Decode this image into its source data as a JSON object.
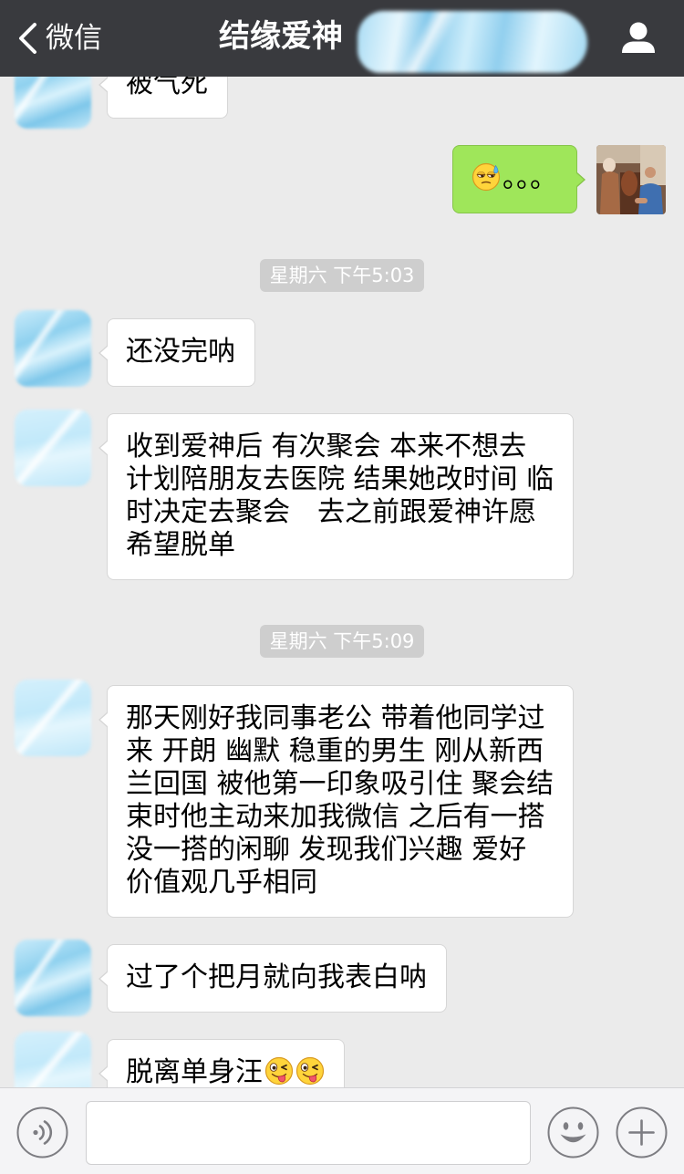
{
  "header": {
    "back_label": "微信",
    "back_icon": "chevron-left-icon",
    "title": "结缘爱神",
    "profile_icon": "person-icon"
  },
  "chat": {
    "items": [
      {
        "outgoing": false,
        "lines": [
          "被气死"
        ]
      },
      {
        "outgoing": true,
        "emoji": "sweat-face-icon",
        "text": "。。。"
      },
      {
        "timestamp": "星期六 下午5:03"
      },
      {
        "outgoing": false,
        "lines": [
          "还没完呐"
        ]
      },
      {
        "outgoing": false,
        "lines": [
          "收到爱神后 有次聚会 本来不想去",
          "计划陪朋友去医院 结果她改时间 临",
          "时决定去聚会　去之前跟爱神许愿",
          "希望脱单"
        ]
      },
      {
        "timestamp": "星期六 下午5:09"
      },
      {
        "outgoing": false,
        "lines": [
          "那天刚好我同事老公 带着他同学过",
          "来 开朗 幽默 稳重的男生 刚从新西",
          "兰回国 被他第一印象吸引住 聚会结",
          "束时他主动来加我微信 之后有一搭",
          "没一搭的闲聊 发现我们兴趣 爱好",
          "价值观几乎相同"
        ]
      },
      {
        "outgoing": false,
        "lines": [
          "过了个把月就向我表白呐"
        ]
      },
      {
        "outgoing": false,
        "lines": [
          "脱离单身汪"
        ],
        "trailing_emoji": [
          "winking-tongue-face-icon",
          "winking-tongue-face-icon"
        ]
      }
    ]
  },
  "input_bar": {
    "voice_icon": "voice-icon",
    "emoji_icon": "emoji-face-icon",
    "more_icon": "plus-icon"
  },
  "colors": {
    "header_bg": "#393a3e",
    "chat_bg": "#ebebeb",
    "bubble_in": "#ffffff",
    "bubble_out": "#9fe65a",
    "timestamp_bg": "#cecece",
    "input_bar_bg": "#f4f4f6"
  }
}
